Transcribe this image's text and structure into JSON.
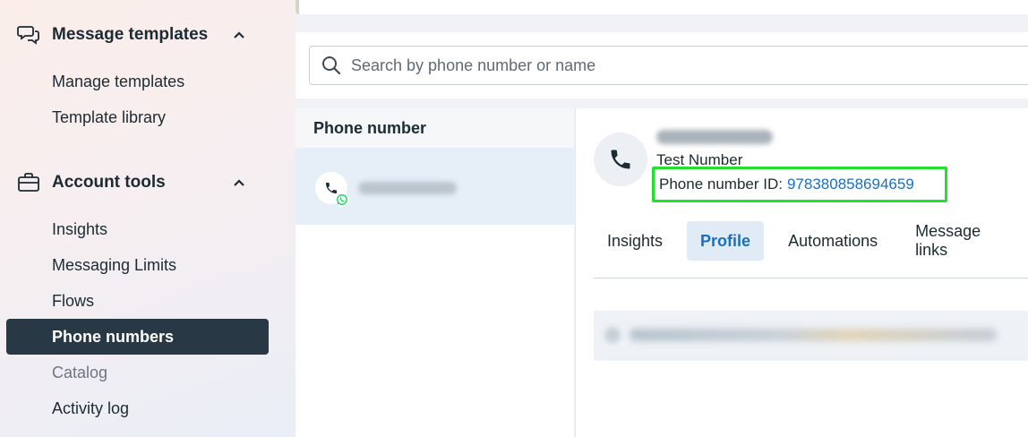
{
  "sidebar": {
    "sections": [
      {
        "label": "Message templates",
        "icon": "chat-bubbles-icon",
        "expanded": true,
        "items": [
          {
            "label": "Manage templates"
          },
          {
            "label": "Template library"
          }
        ]
      },
      {
        "label": "Account tools",
        "icon": "briefcase-icon",
        "expanded": true,
        "items": [
          {
            "label": "Insights"
          },
          {
            "label": "Messaging Limits"
          },
          {
            "label": "Flows"
          },
          {
            "label": "Phone numbers",
            "active": true
          },
          {
            "label": "Catalog",
            "muted": true
          },
          {
            "label": "Activity log"
          }
        ]
      }
    ]
  },
  "search": {
    "placeholder": "Search by phone number or name"
  },
  "list": {
    "header": "Phone number"
  },
  "detail": {
    "type_label": "Test Number",
    "id_label": "Phone number ID:",
    "id_value": "978380858694659",
    "tabs": [
      {
        "label": "Insights"
      },
      {
        "label": "Profile",
        "active": true
      },
      {
        "label": "Automations"
      },
      {
        "label": "Message links"
      }
    ]
  },
  "colors": {
    "active_nav_bg": "#283845",
    "link_blue": "#1a6fbf",
    "highlight_green": "#22e02e",
    "selected_row_bg": "#e6eef8"
  }
}
